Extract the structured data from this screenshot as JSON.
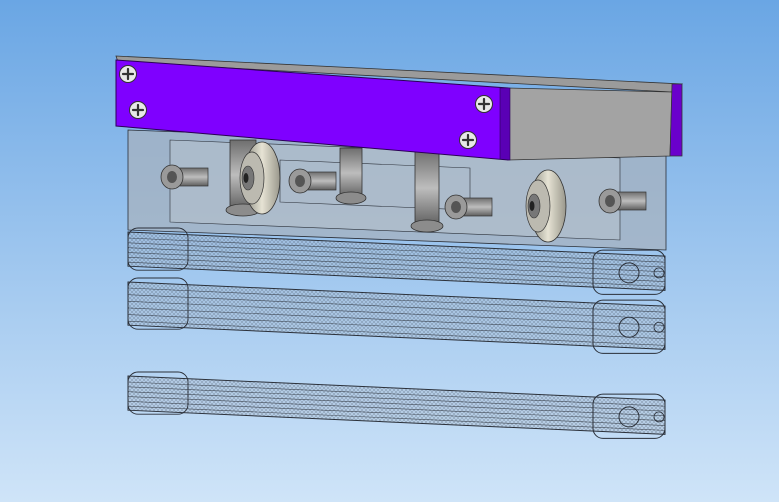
{
  "viewport": {
    "background_top": "#6aa6e4",
    "background_bottom": "#cfe4f8"
  },
  "colors": {
    "plate_front": "#7f00ff",
    "plate_top": "#9b9b9b",
    "plate_side": "#a3a3a3",
    "plate_edge": "#4a007f",
    "rail_line": "#2a2f38",
    "rail_fill": "#aab8c8",
    "housing_fill": "#a6b2bf",
    "bolt_fill": "#8c8c8c",
    "wheel_fill": "#d8d6c8"
  },
  "icons": {
    "screw": "cross-head-screw-icon",
    "bolt": "socket-head-bolt-icon",
    "wheel": "v-groove-wheel-icon"
  },
  "assembly": {
    "rail_count": 3,
    "screw_count": 4,
    "wheel_count": 2,
    "bolt_count": 4,
    "post_count": 3
  }
}
